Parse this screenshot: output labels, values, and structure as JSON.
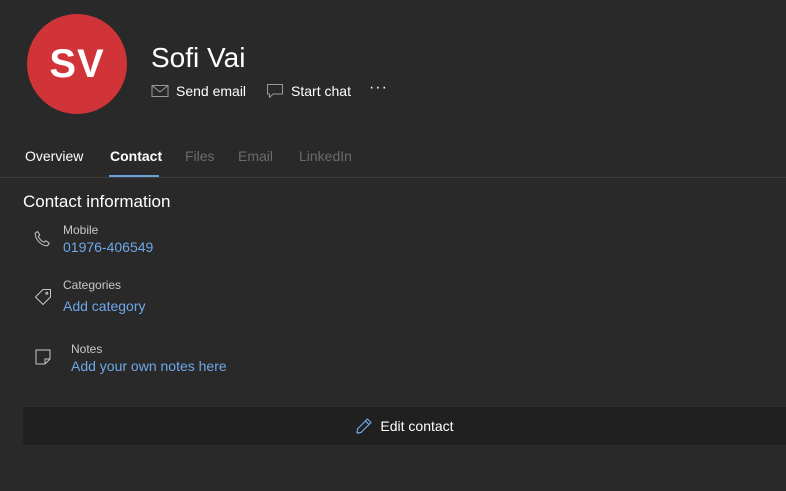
{
  "contact": {
    "initials": "SV",
    "name": "Sofi Vai",
    "avatar_color": "#d13438"
  },
  "actions": {
    "send_email": "Send email",
    "start_chat": "Start chat",
    "more": "···"
  },
  "tabs": [
    {
      "label": "Overview",
      "state": "normal"
    },
    {
      "label": "Contact",
      "state": "active"
    },
    {
      "label": "Files",
      "state": "disabled"
    },
    {
      "label": "Email",
      "state": "disabled"
    },
    {
      "label": "LinkedIn",
      "state": "disabled"
    }
  ],
  "contact_info": {
    "title": "Contact information",
    "mobile": {
      "label": "Mobile",
      "value": "01976-406549",
      "icon": "phone-icon"
    },
    "categories": {
      "label": "Categories",
      "value": "Add category",
      "icon": "tag-icon"
    },
    "notes": {
      "label": "Notes",
      "value": "Add your own notes here",
      "icon": "note-icon"
    }
  },
  "edit": {
    "label": "Edit contact",
    "icon": "pencil-icon"
  },
  "colors": {
    "background": "#292929",
    "link": "#6ea8e8",
    "accent": "#6ca0dc"
  }
}
